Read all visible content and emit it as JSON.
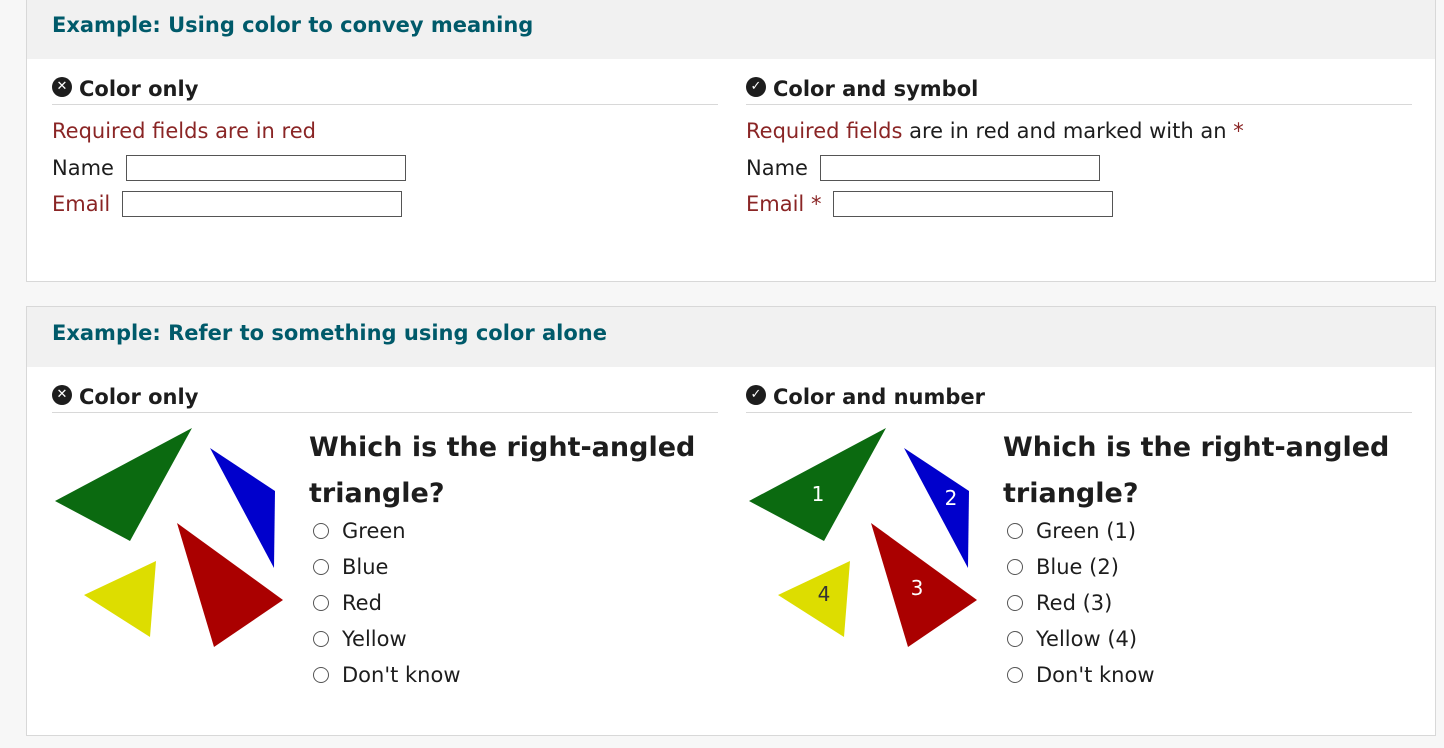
{
  "example1": {
    "heading": "Example: Using color to convey meaning",
    "left": {
      "icon": "cross-circle-icon",
      "title": "Color only",
      "required_note": "Required fields are in red",
      "name_label": "Name",
      "email_label": "Email"
    },
    "right": {
      "icon": "check-circle-icon",
      "title": "Color and symbol",
      "required_note_red": "Required fields",
      "required_note_rest": " are in red and marked with an ",
      "asterisk": "*",
      "name_label": "Name",
      "email_label": "Email",
      "email_asterisk": "*"
    }
  },
  "example2": {
    "heading": "Example: Refer to something using color alone",
    "left": {
      "icon": "cross-circle-icon",
      "title": "Color only",
      "question": "Which is the right-angled triangle?",
      "options": [
        "Green",
        "Blue",
        "Red",
        "Yellow",
        "Don't know"
      ]
    },
    "right": {
      "icon": "check-circle-icon",
      "title": "Color and number",
      "question": "Which is the right-angled triangle?",
      "options": [
        "Green (1)",
        "Blue (2)",
        "Red (3)",
        "Yellow (4)",
        "Don't know"
      ],
      "triangle_numbers": [
        "1",
        "2",
        "3",
        "4"
      ]
    }
  },
  "colors": {
    "header_text": "#005a6a",
    "required_red": "#8a2525",
    "green": "#0b6a10",
    "blue": "#0000cc",
    "red": "#aa0000",
    "yellow": "#dddd00"
  }
}
